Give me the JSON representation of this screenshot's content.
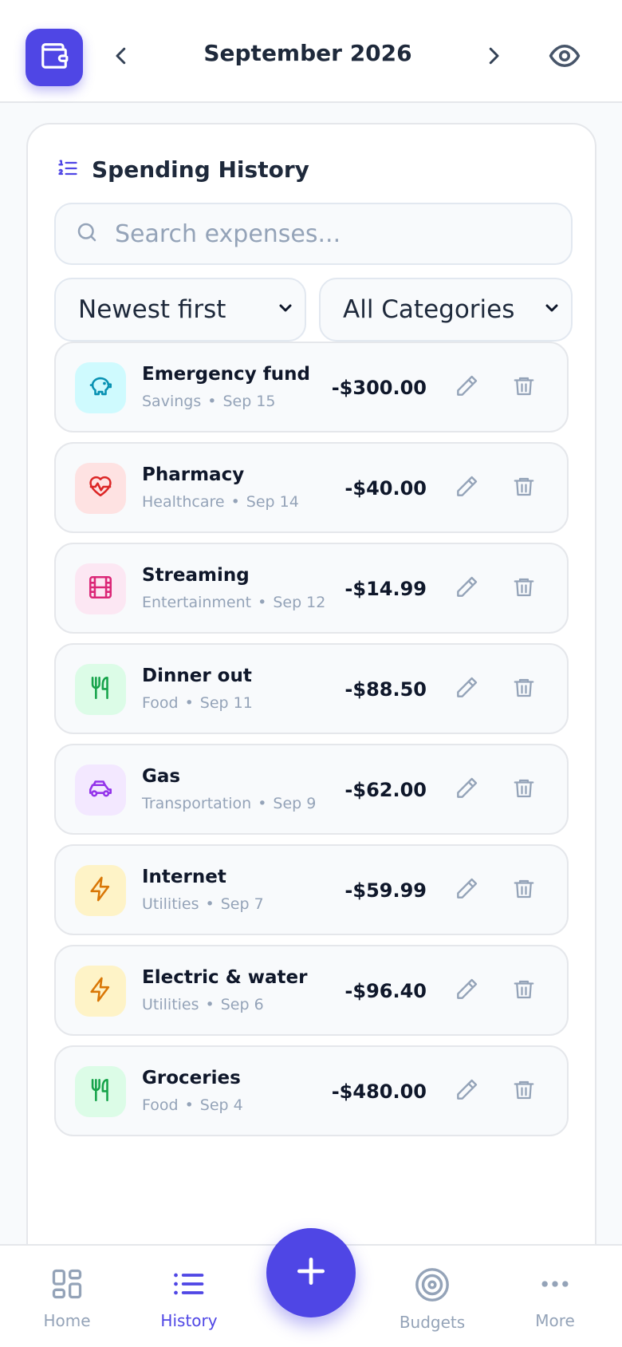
{
  "header": {
    "month": "September 2026",
    "wallet_icon": "wallet-icon",
    "prev_icon": "chevron-left-icon",
    "next_icon": "chevron-right-icon",
    "visibility_icon": "eye-icon"
  },
  "history": {
    "title": "Spending History",
    "search_placeholder": "Search expenses...",
    "sort_selected": "Newest first",
    "category_selected": "All Categories",
    "items": [
      {
        "name": "Emergency fund",
        "category": "Savings",
        "date": "Sep 15",
        "amount": "-$300.00",
        "icon": "piggy-bank-icon",
        "bg": "#cffafe",
        "fg": "#0891b2"
      },
      {
        "name": "Pharmacy",
        "category": "Healthcare",
        "date": "Sep 14",
        "amount": "-$40.00",
        "icon": "heart-pulse-icon",
        "bg": "#fee2e2",
        "fg": "#dc2626"
      },
      {
        "name": "Streaming",
        "category": "Entertainment",
        "date": "Sep 12",
        "amount": "-$14.99",
        "icon": "film-icon",
        "bg": "#fce7f3",
        "fg": "#db2777"
      },
      {
        "name": "Dinner out",
        "category": "Food",
        "date": "Sep 11",
        "amount": "-$88.50",
        "icon": "utensils-icon",
        "bg": "#dcfce7",
        "fg": "#16a34a"
      },
      {
        "name": "Gas",
        "category": "Transportation",
        "date": "Sep 9",
        "amount": "-$62.00",
        "icon": "car-icon",
        "bg": "#f3e8ff",
        "fg": "#9333ea"
      },
      {
        "name": "Internet",
        "category": "Utilities",
        "date": "Sep 7",
        "amount": "-$59.99",
        "icon": "lightning-icon",
        "bg": "#fef3c7",
        "fg": "#d97706"
      },
      {
        "name": "Electric & water",
        "category": "Utilities",
        "date": "Sep 6",
        "amount": "-$96.40",
        "icon": "lightning-icon",
        "bg": "#fef3c7",
        "fg": "#d97706"
      },
      {
        "name": "Groceries",
        "category": "Food",
        "date": "Sep 4",
        "amount": "-$480.00",
        "icon": "utensils-icon",
        "bg": "#dcfce7",
        "fg": "#16a34a"
      }
    ]
  },
  "bottom_nav": {
    "items": [
      {
        "label": "Home",
        "icon": "grid-icon",
        "active": false
      },
      {
        "label": "History",
        "icon": "list-icon",
        "active": true
      },
      {
        "label": "Budgets",
        "icon": "target-icon",
        "active": false
      },
      {
        "label": "More",
        "icon": "more-icon",
        "active": false
      }
    ],
    "add_icon": "plus-icon"
  },
  "colors": {
    "accent": "#4f46e5",
    "muted": "#94a3b8",
    "text": "#0f172a"
  }
}
